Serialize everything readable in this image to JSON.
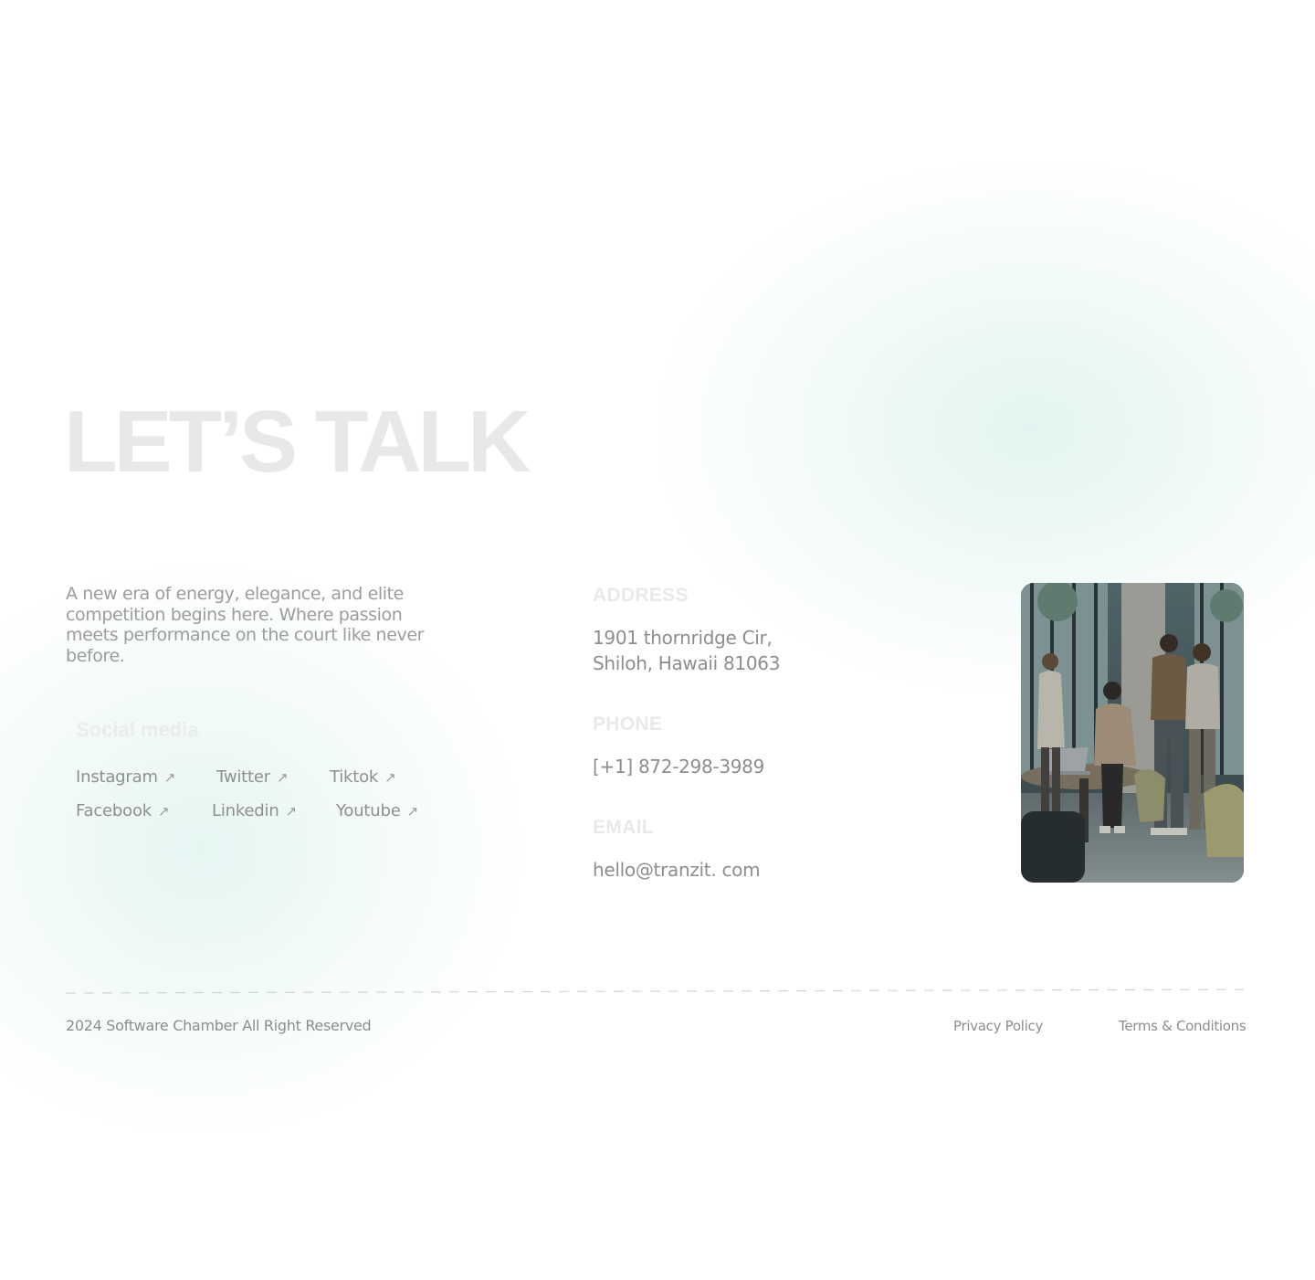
{
  "hero": {
    "title": "LET’S TALK",
    "intro": "A new era of energy, elegance, and elite competition begins here.  Where passion meets performance on the court like never before."
  },
  "social": {
    "title": "Social media",
    "links": [
      {
        "label": "Instagram",
        "icon": "arrow-up-right-icon"
      },
      {
        "label": "Twitter",
        "icon": "arrow-up-right-icon"
      },
      {
        "label": "Tiktok",
        "icon": "arrow-up-right-icon"
      },
      {
        "label": "Facebook",
        "icon": "arrow-up-right-icon"
      },
      {
        "label": "Linkedin",
        "icon": "arrow-up-right-icon"
      },
      {
        "label": "Youtube",
        "icon": "arrow-up-right-icon"
      }
    ],
    "arrow_glyph": "↗"
  },
  "contact": {
    "address_label": "ADDRESS",
    "address_line1": "1901 thornridge Cir,",
    "address_line2": "Shiloh, Hawaii 81063",
    "phone_label": "PHONE",
    "phone": "[+1] 872-298-3989",
    "email_label": "EMAIL",
    "email": "hello@tranzit. com"
  },
  "footer": {
    "copyright": "2024 Software Chamber All Right Reserved",
    "privacy": "Privacy Policy",
    "terms": "Terms & Conditions"
  },
  "colors": {
    "accent_glow": "#cbece5",
    "text_muted": "#8d8d8d",
    "heading_faint": "#e8e8e8"
  }
}
